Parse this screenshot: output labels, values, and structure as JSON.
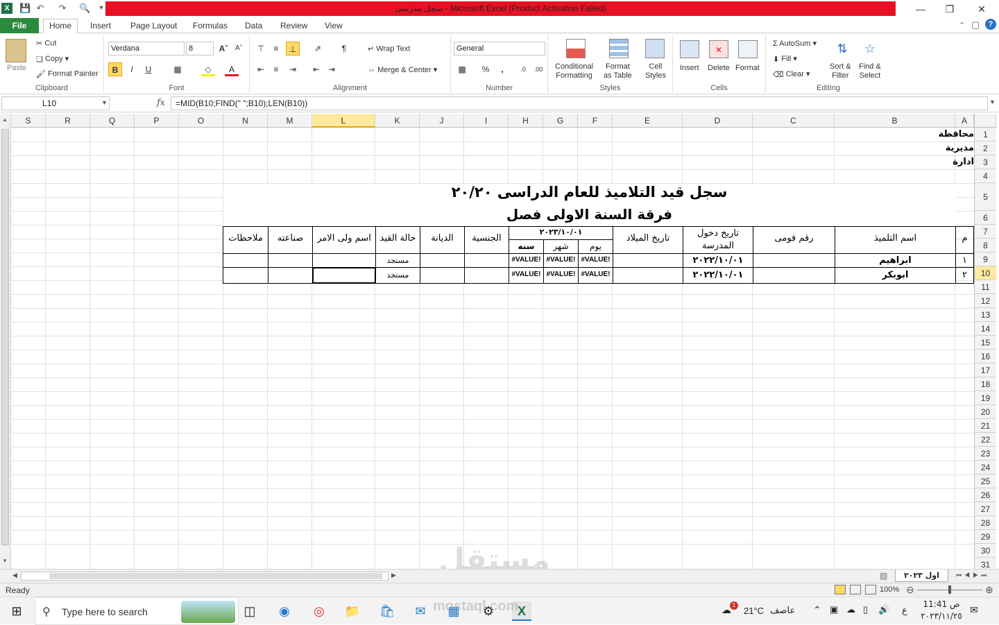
{
  "window": {
    "title": "سجل مدرسى  -  Microsoft Excel (Product Activation Failed)"
  },
  "tabs": [
    "File",
    "Home",
    "Insert",
    "Page Layout",
    "Formulas",
    "Data",
    "Review",
    "View"
  ],
  "ribbon": {
    "clipboard": {
      "paste": "Paste",
      "cut": "Cut",
      "copy": "Copy",
      "format_painter": "Format Painter",
      "label": "Clipboard"
    },
    "font": {
      "name": "Verdana",
      "size": "8",
      "label": "Font",
      "bold": "B",
      "italic": "I",
      "underline": "U"
    },
    "alignment": {
      "wrap": "Wrap Text",
      "merge": "Merge & Center",
      "label": "Alignment"
    },
    "number": {
      "format": "General",
      "percent": "%",
      "comma": ",",
      "label": "Number"
    },
    "styles": {
      "conditional": "Conditional",
      "conditional2": "Formatting",
      "format_as": "Format",
      "format_as2": "as Table",
      "cell": "Cell",
      "cell2": "Styles",
      "label": "Styles"
    },
    "cells": {
      "insert": "Insert",
      "delete": "Delete",
      "format": "Format",
      "label": "Cells"
    },
    "editing": {
      "autosum": "AutoSum",
      "fill": "Fill",
      "clear": "Clear",
      "sort": "Sort &",
      "sort2": "Filter",
      "find": "Find &",
      "find2": "Select",
      "label": "Editing"
    }
  },
  "formula_bar": {
    "cell": "L10",
    "fx": "fx",
    "formula": "=MID(B10;FIND(\" \";B10);LEN(B10))"
  },
  "columns": [
    "S",
    "R",
    "Q",
    "P",
    "O",
    "N",
    "M",
    "L",
    "K",
    "J",
    "I",
    "H",
    "G",
    "F",
    "E",
    "D",
    "C",
    "B",
    "A"
  ],
  "rows": [
    "1",
    "2",
    "3",
    "4",
    "5",
    "6",
    "7",
    "8",
    "9",
    "10",
    "11",
    "12",
    "13",
    "14",
    "15",
    "16",
    "17",
    "18",
    "19",
    "20",
    "21",
    "22",
    "23",
    "24",
    "25",
    "26",
    "27",
    "28",
    "29",
    "30",
    "31"
  ],
  "sheet": {
    "a1": "محافظة",
    "a2": "مديرية",
    "a3": "ادارة",
    "title1": "سجل قيد التلاميذ للعام الدراسى ٢٠/٢٠",
    "title2": "فرقة السنة الاولى فصل",
    "headers": {
      "m": "م",
      "name": "اسم التلميذ",
      "national": "رقم قومى",
      "entry": "تاريخ دخول المدرسة",
      "birth": "تاريخ الميلاد",
      "date": "٢٠٢٣/١٠/٠١",
      "day": "يوم",
      "month": "شهر",
      "year": "سنه",
      "nationality": "الجنسية",
      "religion": "الديانة",
      "status": "حالة القيد",
      "guardian": "اسم ولى الامر",
      "job": "صناعته",
      "notes": "ملاحظات"
    },
    "rows": [
      {
        "m": "١",
        "name": "ابراهيم",
        "entry": "٢٠٢٢/١٠/٠١",
        "day": "#VALUE!",
        "month": "#VALUE!",
        "year": "#VALUE!",
        "status": "مستجد"
      },
      {
        "m": "٢",
        "name": "ابوبكر",
        "entry": "٢٠٢٢/١٠/٠١",
        "day": "#VALUE!",
        "month": "#VALUE!",
        "year": "#VALUE!",
        "status": "مستجد"
      }
    ]
  },
  "sheet_tab": "اول ٢٠٢٣",
  "status": {
    "ready": "Ready",
    "zoom": "100%"
  },
  "taskbar": {
    "search": "Type here to search",
    "weather": "21°C",
    "weather_text": "عاصف",
    "time": "11:41 ص",
    "date": "٢٠٢٣/١١/٢٥",
    "lang": "ع",
    "badge": "1"
  },
  "watermark": {
    "text": "مستقل",
    "url": "mostaql.com"
  }
}
